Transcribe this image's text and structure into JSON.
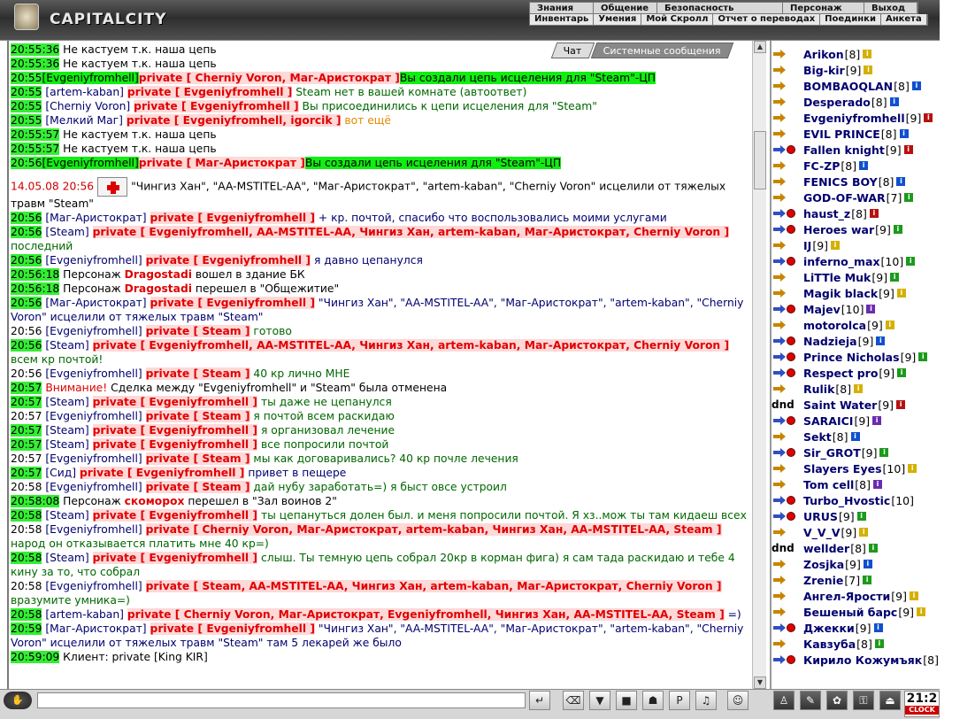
{
  "app": {
    "title": "CAPITALCITY"
  },
  "menu_top": [
    "Знания",
    "Общение",
    "Безопасность",
    "Персонаж",
    "Выход"
  ],
  "menu_bottom": [
    "Инвентарь",
    "Умения",
    "Мой Скролл",
    "Отчет о переводах",
    "Поединки",
    "Анкета"
  ],
  "tabs": {
    "chat": "Чат",
    "system": "Системные сообщения"
  },
  "chat": {
    "l01": {
      "time": "20:55:36",
      "text": "Не кастуем т.к. наша цепь"
    },
    "l02": {
      "time": "20:55:36",
      "text": "Не кастуем т.к. наша цепь"
    },
    "l03": {
      "time": "20:55",
      "nick": "[Evgeniyfromhell]",
      "priv": "private [ Cherniy Voron, Маг-Аристократ ]",
      "msg": "Вы создали цепь исцеления для \"Steam\"-ЦП"
    },
    "l04": {
      "time": "20:55",
      "nick": "[artem-kaban]",
      "priv": "private [ Evgeniyfromhell ]",
      "msg": "Steam нет в вашей комнате (автоответ)"
    },
    "l05": {
      "time": "20:55",
      "nick": "[Cherniy Voron]",
      "priv": "private [ Evgeniyfromhell ]",
      "msg": "Вы присоединились к цепи исцеления для \"Steam\""
    },
    "l06": {
      "time": "20:55",
      "nick": "[Мелкий Маг]",
      "priv": "private [ Evgeniyfromhell, igorcik ]",
      "msg": "вот ещё"
    },
    "l07": {
      "time": "20:55:57",
      "text": "Не кастуем т.к. наша цепь"
    },
    "l08": {
      "time": "20:55:57",
      "text": "Не кастуем т.к. наша цепь"
    },
    "l09": {
      "time": "20:56",
      "nick": "[Evgeniyfromhell]",
      "priv": "private [ Маг-Аристократ ]",
      "msg": "Вы создали цепь исцеления для \"Steam\"-ЦП"
    },
    "l10": {
      "time": "14.05.08 20:56",
      "text": "\"Чингиз Хан\", \"AA-MSTITEL-AA\", \"Маг-Аристократ\", \"artem-kaban\", \"Cherniy Voron\" исцелили от тяжелых травм \"Steam\""
    },
    "l11": {
      "time": "20:56",
      "nick": "[Маг-Аристократ]",
      "priv": "private [ Evgeniyfromhell ]",
      "msg": "+ кр. почтой, спасибо что воспользовались моими услугами"
    },
    "l12": {
      "time": "20:56",
      "nick": "[Steam]",
      "priv": "private [ Evgeniyfromhell, AA-MSTITEL-AA, Чингиз Хан, artem-kaban, Маг-Аристократ, Cherniy Voron ]",
      "msg": "последний"
    },
    "l13": {
      "time": "20:56",
      "nick": "[Evgeniyfromhell]",
      "priv": "private [ Evgeniyfromhell ]",
      "msg": "я давно цепанулся"
    },
    "l14": {
      "time": "20:56:18",
      "pre": "Персонаж",
      "who": "Dragostadi",
      "post": "вошел в здание БК"
    },
    "l15": {
      "time": "20:56:18",
      "pre": "Персонаж",
      "who": "Dragostadi",
      "post": "перешел в \"Общежитие\""
    },
    "l16": {
      "time": "20:56",
      "nick": "[Маг-Аристократ]",
      "priv": "private [ Evgeniyfromhell ]",
      "msg": "\"Чингиз Хан\", \"AA-MSTITEL-AA\", \"Маг-Аристократ\", \"artem-kaban\", \"Cherniy Voron\" исцелили от тяжелых травм \"Steam\""
    },
    "l17": {
      "time": "20:56",
      "nick": "[Evgeniyfromhell]",
      "priv": "private [ Steam ]",
      "msg": "готово"
    },
    "l18": {
      "time": "20:56",
      "nick": "[Steam]",
      "priv": "private [ Evgeniyfromhell, AA-MSTITEL-AA, Чингиз Хан, artem-kaban, Маг-Аристократ, Cherniy Voron ]",
      "msg": "всем кр почтой!"
    },
    "l19": {
      "time": "20:56",
      "nick": "[Evgeniyfromhell]",
      "priv": "private [ Steam ]",
      "msg": "40 кр лично МНЕ"
    },
    "l20": {
      "time": "20:57",
      "warn": "Внимание!",
      "text": "Сделка между \"Evgeniyfromhell\" и \"Steam\" была отменена"
    },
    "l21": {
      "time": "20:57",
      "nick": "[Steam]",
      "priv": "private [ Evgeniyfromhell ]",
      "msg": "ты даже не цепанулся"
    },
    "l22": {
      "time": "20:57",
      "nick": "[Evgeniyfromhell]",
      "priv": "private [ Steam ]",
      "msg": "я почтой всем раскидаю"
    },
    "l23": {
      "time": "20:57",
      "nick": "[Steam]",
      "priv": "private [ Evgeniyfromhell ]",
      "msg": "я организовал лечение"
    },
    "l24": {
      "time": "20:57",
      "nick": "[Steam]",
      "priv": "private [ Evgeniyfromhell ]",
      "msg": "все попросили почтой"
    },
    "l25": {
      "time": "20:57",
      "nick": "[Evgeniyfromhell]",
      "priv": "private [ Steam ]",
      "msg": "мы как договаривались? 40 кр почле лечения"
    },
    "l26": {
      "time": "20:57",
      "nick": "[Сид]",
      "priv": "private [ Evgeniyfromhell ]",
      "msg": "привет в пещере"
    },
    "l27": {
      "time": "20:58",
      "nick": "[Evgeniyfromhell]",
      "priv": "private [ Steam ]",
      "msg": "дай нубу заработать=) я быст овсе устроил"
    },
    "l28": {
      "time": "20:58:08",
      "pre": "Персонаж",
      "who": "скоморох",
      "post": "перешел в \"Зал воинов 2\""
    },
    "l29": {
      "time": "20:58",
      "nick": "[Steam]",
      "priv": "private [ Evgeniyfromhell ]",
      "msg": "ты цепануться долен был. и меня попросили почтой. Я хз..мож ты там кидаеш всех"
    },
    "l30": {
      "time": "20:58",
      "nick": "[Evgeniyfromhell]",
      "priv": "private [ Cherniy Voron, Маг-Аристократ, artem-kaban, Чингиз Хан, AA-MSTITEL-AA, Steam ]",
      "msg": "народ он отказывается платить мне 40 кр=)"
    },
    "l31": {
      "time": "20:58",
      "nick": "[Steam]",
      "priv": "private [ Evgeniyfromhell ]",
      "msg": "слыш. Ты темную цепь собрал 20кр в корман фига) я сам тада раскидаю и тебе 4 кину за то, что собрал"
    },
    "l32": {
      "time": "20:58",
      "nick": "[Evgeniyfromhell]",
      "priv": "private [ Steam, AA-MSTITEL-AA, Чингиз Хан, artem-kaban, Маг-Аристократ, Cherniy Voron ]",
      "msg": "вразумите умника=)"
    },
    "l33": {
      "time": "20:58",
      "nick": "[artem-kaban]",
      "priv": "private [ Cherniy Voron, Маг-Аристократ, Evgeniyfromhell, Чингиз Хан, AA-MSTITEL-AA, Steam ]",
      "msg": "=)"
    },
    "l34": {
      "time": "20:59",
      "nick": "[Маг-Аристократ]",
      "priv": "private [ Evgeniyfromhell ]",
      "msg": "\"Чингиз Хан\", \"AA-MSTITEL-AA\", \"Маг-Аристократ\", \"artem-kaban\", \"Cherniy Voron\" исцелили от тяжелых травм \"Steam\" там 5 лекарей же было"
    },
    "l35": {
      "time": "20:59:09",
      "text": "Клиент: private [King KIR]"
    }
  },
  "users": [
    {
      "name": "Arikon",
      "lvl": "[8]",
      "info": "yellow",
      "arrow": "orange"
    },
    {
      "name": "Big-kir",
      "lvl": "[9]",
      "info": "yellow",
      "arrow": "orange"
    },
    {
      "name": "BOMBAOQLAN",
      "lvl": "[8]",
      "info": "blue",
      "arrow": "orange"
    },
    {
      "name": "Desperado",
      "lvl": "[8]",
      "info": "blue",
      "arrow": "orange"
    },
    {
      "name": "Evgeniyfromhell",
      "lvl": "[9]",
      "info": "red",
      "arrow": "orange"
    },
    {
      "name": "EVIL PRINCE",
      "lvl": "[8]",
      "info": "blue",
      "arrow": "orange"
    },
    {
      "name": "Fallen knight",
      "lvl": "[9]",
      "info": "red",
      "arrow": "blue"
    },
    {
      "name": "FC-ZP",
      "lvl": "[8]",
      "info": "blue",
      "arrow": "orange"
    },
    {
      "name": "FENICS BOY",
      "lvl": "[8]",
      "info": "blue",
      "arrow": "orange"
    },
    {
      "name": "GOD-OF-WAR",
      "lvl": "[7]",
      "info": "green",
      "arrow": "orange"
    },
    {
      "name": "haust_z",
      "lvl": "[8]",
      "info": "red",
      "arrow": "blue"
    },
    {
      "name": "Heroes war",
      "lvl": "[9]",
      "info": "green",
      "arrow": "blue"
    },
    {
      "name": "IJ",
      "lvl": "[9]",
      "info": "yellow",
      "arrow": "orange"
    },
    {
      "name": "inferno_max",
      "lvl": "[10]",
      "info": "green",
      "arrow": "blue"
    },
    {
      "name": "LiTTle Muk",
      "lvl": "[9]",
      "info": "green",
      "arrow": "orange"
    },
    {
      "name": "Magik black",
      "lvl": "[9]",
      "info": "yellow",
      "arrow": "orange"
    },
    {
      "name": "Majev",
      "lvl": "[10]",
      "info": "purple",
      "arrow": "blue"
    },
    {
      "name": "motorolca",
      "lvl": "[9]",
      "info": "yellow",
      "arrow": "orange"
    },
    {
      "name": "Nadzieja",
      "lvl": "[9]",
      "info": "blue",
      "arrow": "blue"
    },
    {
      "name": "Prince Nicholas",
      "lvl": "[9]",
      "info": "green",
      "arrow": "blue"
    },
    {
      "name": "Respect pro",
      "lvl": "[9]",
      "info": "green",
      "arrow": "blue"
    },
    {
      "name": "Rulik",
      "lvl": "[8]",
      "info": "yellow",
      "arrow": "orange"
    },
    {
      "name": "Saint Water",
      "lvl": "[9]",
      "info": "red",
      "arrow": "none",
      "prefix": "dnd"
    },
    {
      "name": "SARAICI",
      "lvl": "[9]",
      "info": "purple",
      "arrow": "blue"
    },
    {
      "name": "Sekt",
      "lvl": "[8]",
      "info": "blue",
      "arrow": "orange"
    },
    {
      "name": "Sir_GROT",
      "lvl": "[9]",
      "info": "green",
      "arrow": "blue"
    },
    {
      "name": "Slayers Eyes",
      "lvl": "[10]",
      "info": "yellow",
      "arrow": "orange"
    },
    {
      "name": "Tom cell",
      "lvl": "[8]",
      "info": "purple",
      "arrow": "orange"
    },
    {
      "name": "Turbo_Hvostic",
      "lvl": "[10]",
      "info": "",
      "arrow": "blue"
    },
    {
      "name": "URUS",
      "lvl": "[9]",
      "info": "green",
      "arrow": "blue"
    },
    {
      "name": "V_V_V",
      "lvl": "[9]",
      "info": "yellow",
      "arrow": "orange"
    },
    {
      "name": "wellder",
      "lvl": "[8]",
      "info": "green",
      "arrow": "none",
      "prefix": "dnd"
    },
    {
      "name": "Zosjka",
      "lvl": "[9]",
      "info": "blue",
      "arrow": "orange"
    },
    {
      "name": "Zrenie",
      "lvl": "[7]",
      "info": "green",
      "arrow": "orange"
    },
    {
      "name": "Ангел-Ярости",
      "lvl": "[9]",
      "info": "yellow",
      "arrow": "orange"
    },
    {
      "name": "Бешеный барс",
      "lvl": "[9]",
      "info": "yellow",
      "arrow": "orange"
    },
    {
      "name": "Джекки",
      "lvl": "[9]",
      "info": "blue",
      "arrow": "blue"
    },
    {
      "name": "Кавзуба",
      "lvl": "[8]",
      "info": "green",
      "arrow": "orange"
    },
    {
      "name": "Кирило Кожумъяк",
      "lvl": "[8]",
      "info": "yellow",
      "arrow": "blue"
    }
  ],
  "clock": {
    "time": "21:2",
    "label": "CLOCK"
  },
  "colors": {
    "time_highlight": "#33ee33",
    "private": "#e00000",
    "nick": "#00006e"
  }
}
